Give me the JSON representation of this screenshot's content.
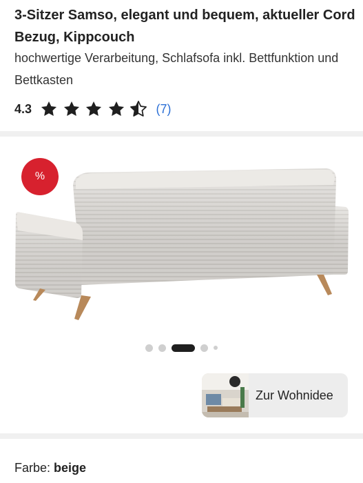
{
  "product": {
    "title": "3-Sitzer Samso, elegant und bequem, aktueller Cord Bezug, Kippcouch",
    "subtitle": "hochwertige Verarbeitung, Schlafsofa inkl. Bettfunktion und Bettkasten",
    "rating": {
      "value": "4.3",
      "stars_filled": 4,
      "stars_half": 1,
      "stars_total": 5,
      "count": "(7)"
    }
  },
  "gallery": {
    "badge": "%",
    "image_icon": "sofa-back-view",
    "dots_total": 5,
    "active_dot": 3
  },
  "wohnidee": {
    "label": "Zur Wohnidee",
    "thumb_icon": "living-room-thumbnail"
  },
  "color": {
    "label": "Farbe:",
    "value": "beige"
  },
  "colors": {
    "badge_red": "#d7212e",
    "star": "#1f1f1f",
    "link_blue": "#2b6fd6",
    "divider": "#f0f0f0"
  }
}
